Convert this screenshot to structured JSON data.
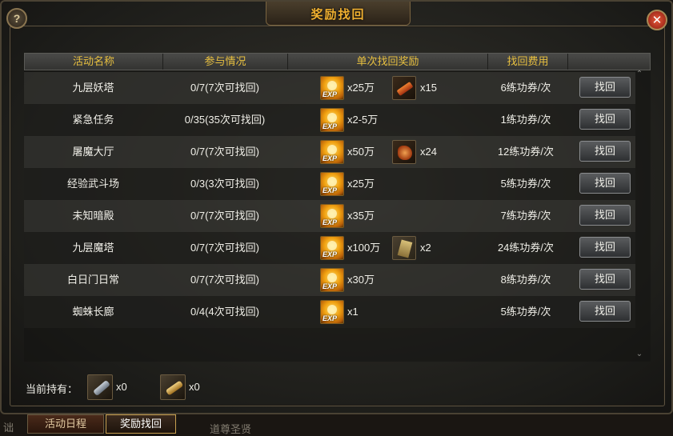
{
  "window": {
    "title": "奖励找回"
  },
  "table": {
    "headers": [
      "活动名称",
      "参与情况",
      "单次找回奖励",
      "找回费用"
    ],
    "rows": [
      {
        "name": "九层妖塔",
        "participation": "0/7(7次可找回)",
        "exp": "x25万",
        "item_icon": "item-scroll",
        "item_qty": "x15",
        "cost": "6练功券/次",
        "button": "找回"
      },
      {
        "name": "紧急任务",
        "participation": "0/35(35次可找回)",
        "exp": "x2-5万",
        "item_icon": "",
        "item_qty": "",
        "cost": "1练功券/次",
        "button": "找回"
      },
      {
        "name": "屠魔大厅",
        "participation": "0/7(7次可找回)",
        "exp": "x50万",
        "item_icon": "item-claw",
        "item_qty": "x24",
        "cost": "12练功券/次",
        "button": "找回"
      },
      {
        "name": "经验武斗场",
        "participation": "0/3(3次可找回)",
        "exp": "x25万",
        "item_icon": "",
        "item_qty": "",
        "cost": "5练功券/次",
        "button": "找回"
      },
      {
        "name": "未知暗殿",
        "participation": "0/7(7次可找回)",
        "exp": "x35万",
        "item_icon": "",
        "item_qty": "",
        "cost": "7练功券/次",
        "button": "找回"
      },
      {
        "name": "九层魔塔",
        "participation": "0/7(7次可找回)",
        "exp": "x100万",
        "item_icon": "item-paper",
        "item_qty": "x2",
        "cost": "24练功券/次",
        "button": "找回"
      },
      {
        "name": "白日门日常",
        "participation": "0/7(7次可找回)",
        "exp": "x30万",
        "item_icon": "",
        "item_qty": "",
        "cost": "8练功券/次",
        "button": "找回"
      },
      {
        "name": "蜘蛛长廊",
        "participation": "0/4(4次可找回)",
        "exp": "x1",
        "item_icon": "",
        "item_qty": "",
        "cost": "5练功券/次",
        "button": "找回"
      }
    ]
  },
  "footer": {
    "label": "当前持有：",
    "holdings": [
      {
        "icon": "silver-scroll-icon",
        "qty": "x0"
      },
      {
        "icon": "gold-scroll-icon",
        "qty": "x0"
      }
    ]
  },
  "tabs": [
    {
      "label": "活动日程",
      "active": false
    },
    {
      "label": "奖励找回",
      "active": true
    }
  ],
  "background_text": {
    "left": "诎",
    "bottom": "道尊圣贤"
  }
}
